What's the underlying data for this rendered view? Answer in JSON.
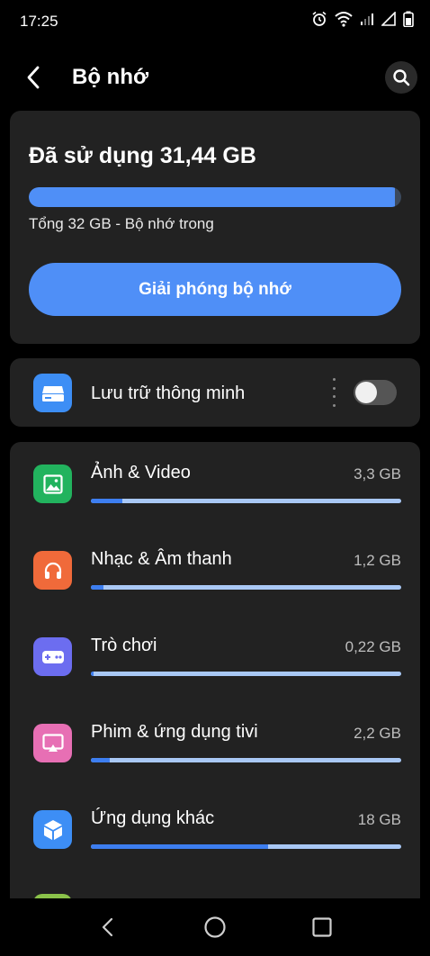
{
  "status_bar": {
    "time": "17:25",
    "icons": [
      "alarm-icon",
      "wifi-icon",
      "signal-icon",
      "signal-icon",
      "battery-icon"
    ]
  },
  "app_bar": {
    "title": "Bộ nhớ",
    "back_icon": "chevron-left-icon",
    "search_icon": "search-icon"
  },
  "storage": {
    "used_label": "Đã sử dụng 31,44 GB",
    "used_fraction": 0.983,
    "total_label": "Tổng 32 GB - Bộ nhớ trong",
    "free_button_label": "Giải phóng bộ nhớ"
  },
  "smart_storage": {
    "label": "Lưu trữ thông minh",
    "toggle_on": false,
    "icon": "drive-icon"
  },
  "categories": [
    {
      "name": "Ảnh & Video",
      "size": "3,3 GB",
      "fraction": 0.1,
      "icon": "image-icon",
      "color": "#22b35e"
    },
    {
      "name": "Nhạc & Âm thanh",
      "size": "1,2 GB",
      "fraction": 0.04,
      "icon": "headphones-icon",
      "color": "#f06a3a"
    },
    {
      "name": "Trò chơi",
      "size": "0,22 GB",
      "fraction": 0.007,
      "icon": "gamepad-icon",
      "color": "#6c6df0"
    },
    {
      "name": "Phim & ứng dụng tivi",
      "size": "2,2 GB",
      "fraction": 0.06,
      "icon": "tv-icon",
      "color": "#e76fb4"
    },
    {
      "name": "Ứng dụng khác",
      "size": "18 GB",
      "fraction": 0.57,
      "icon": "cube-icon",
      "color": "#3d8ef5"
    }
  ],
  "nav_bar": {
    "back": "back-triangle-icon",
    "home": "home-circle-icon",
    "recents": "recents-square-icon"
  },
  "colors": {
    "accent": "#4f8ff7",
    "card_bg": "#222222",
    "background": "#000000"
  }
}
